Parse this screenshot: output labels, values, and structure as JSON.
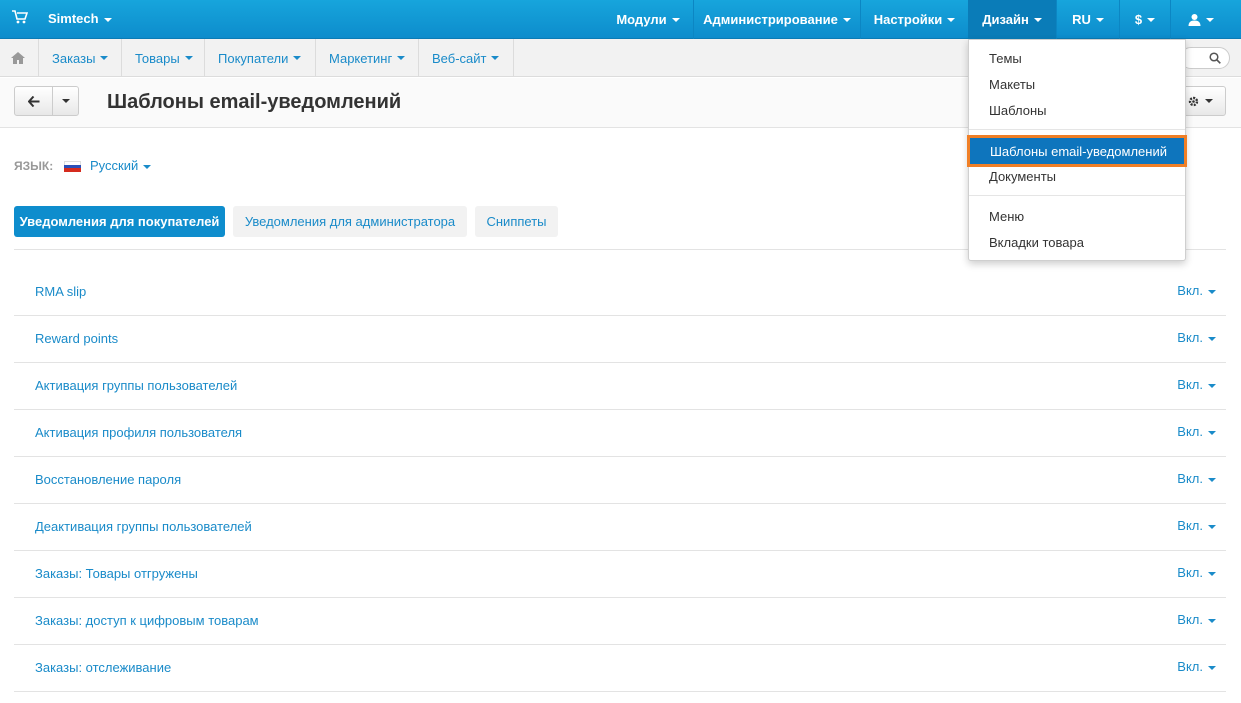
{
  "topbar": {
    "brand": "Simtech",
    "nav": [
      {
        "label": "Модули"
      },
      {
        "label": "Администрирование"
      },
      {
        "label": "Настройки"
      },
      {
        "label": "Дизайн"
      },
      {
        "label": "RU"
      },
      {
        "label": "$"
      }
    ]
  },
  "subnav": {
    "items": [
      {
        "label": "Заказы"
      },
      {
        "label": "Товары"
      },
      {
        "label": "Покупатели"
      },
      {
        "label": "Маркетинг"
      },
      {
        "label": "Веб-сайт"
      }
    ]
  },
  "header": {
    "title": "Шаблоны email-уведомлений"
  },
  "language": {
    "label": "ЯЗЫК:",
    "value": "Русский"
  },
  "tabs": [
    {
      "label": "Уведомления для покупателей",
      "active": true
    },
    {
      "label": "Уведомления для администратора",
      "active": false
    },
    {
      "label": "Сниппеты",
      "active": false
    }
  ],
  "templates": [
    {
      "name": "RMA slip",
      "status": "Вкл."
    },
    {
      "name": "Reward points",
      "status": "Вкл."
    },
    {
      "name": "Активация группы пользователей",
      "status": "Вкл."
    },
    {
      "name": "Активация профиля пользователя",
      "status": "Вкл."
    },
    {
      "name": "Восстановление пароля",
      "status": "Вкл."
    },
    {
      "name": "Деактивация группы пользователей",
      "status": "Вкл."
    },
    {
      "name": "Заказы: Товары отгружены",
      "status": "Вкл."
    },
    {
      "name": "Заказы: доступ к цифровым товарам",
      "status": "Вкл."
    },
    {
      "name": "Заказы: отслеживание",
      "status": "Вкл."
    }
  ],
  "design_menu": {
    "items": [
      {
        "label": "Темы"
      },
      {
        "label": "Макеты"
      },
      {
        "label": "Шаблоны"
      },
      {
        "label": "Шаблоны email-уведомлений",
        "highlighted": true
      },
      {
        "label": "Документы"
      },
      {
        "label": "Меню"
      },
      {
        "label": "Вкладки товара"
      }
    ]
  },
  "colors": {
    "topbar": "#0e8dcd",
    "link": "#1a8bc9",
    "highlight_outline": "#f07f26"
  }
}
